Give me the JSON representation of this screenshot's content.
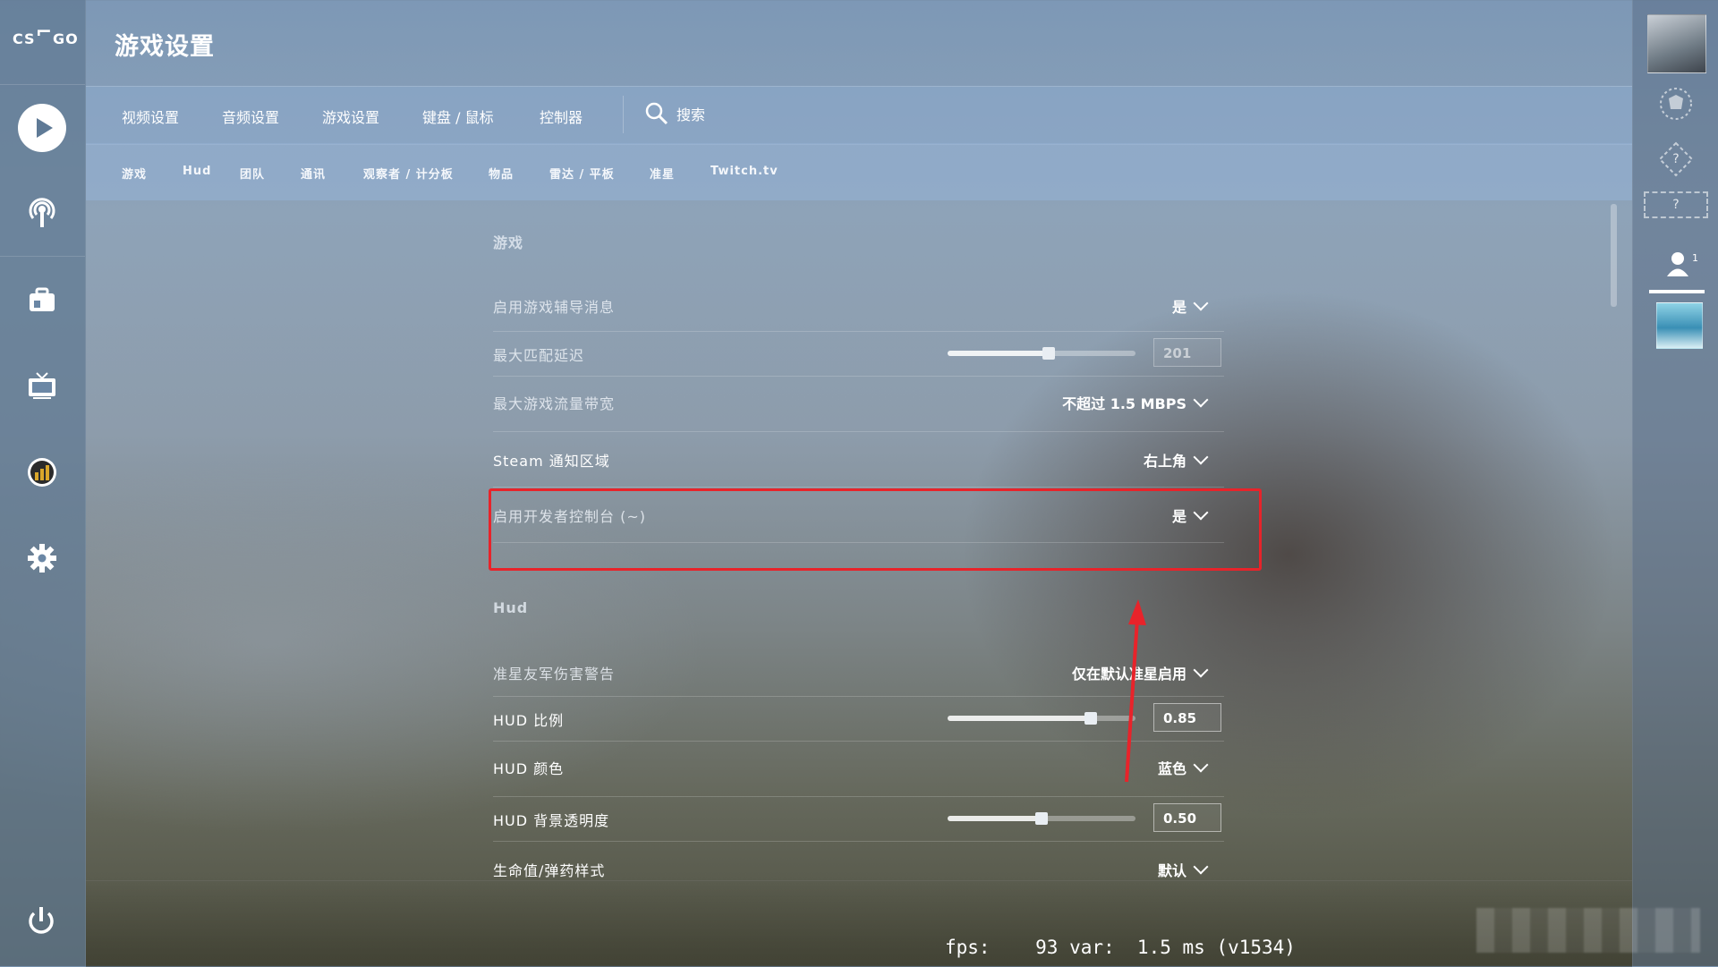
{
  "app": {
    "logo_text": "CS",
    "logo_text2": "GO"
  },
  "header": {
    "title": "游戏设置"
  },
  "primary_tabs": [
    {
      "label": "视频设置"
    },
    {
      "label": "音频设置"
    },
    {
      "label": "游戏设置"
    },
    {
      "label": "键盘 / 鼠标"
    },
    {
      "label": "控制器"
    }
  ],
  "search": {
    "label": "搜索"
  },
  "secondary_tabs": [
    {
      "label": "游戏"
    },
    {
      "label": "Hud"
    },
    {
      "label": "团队"
    },
    {
      "label": "通讯"
    },
    {
      "label": "观察者 / 计分板"
    },
    {
      "label": "物品"
    },
    {
      "label": "雷达 / 平板"
    },
    {
      "label": "准星"
    },
    {
      "label": "Twitch.tv"
    }
  ],
  "sections": {
    "game": {
      "title": "游戏",
      "rows": [
        {
          "label": "启用游戏辅导消息",
          "value": "是"
        },
        {
          "label": "最大匹配延迟",
          "value": "201",
          "slider_fraction": 0.54
        },
        {
          "label": "最大游戏流量带宽",
          "value": "不超过 1.5 MBPS"
        },
        {
          "label": "Steam 通知区域",
          "value": "右上角"
        },
        {
          "label": "启用开发者控制台 (~)",
          "value": "是"
        }
      ]
    },
    "hud": {
      "title": "Hud",
      "rows": [
        {
          "label": "准星友军伤害警告",
          "value": "仅在默认准星启用"
        },
        {
          "label": "HUD 比例",
          "value": "0.85",
          "slider_fraction": 0.76
        },
        {
          "label": "HUD 颜色",
          "value": "蓝色"
        },
        {
          "label": "HUD 背景透明度",
          "value": "0.50",
          "slider_fraction": 0.5
        },
        {
          "label": "生命值/弹药样式",
          "value": "默认"
        }
      ]
    }
  },
  "friends": {
    "count": "1"
  },
  "rank_placeholders": [
    "?",
    "?"
  ],
  "footer": {
    "fps_text": "fps:    93 var:  1.5 ms (v1534)"
  },
  "colors": {
    "highlight": "#e8232a"
  },
  "icons": [
    "play-icon",
    "broadcast-icon",
    "inventory-icon",
    "watch-icon",
    "stats-icon",
    "gear-icon",
    "power-icon",
    "search-icon",
    "chevron-down-icon",
    "friend-icon"
  ]
}
